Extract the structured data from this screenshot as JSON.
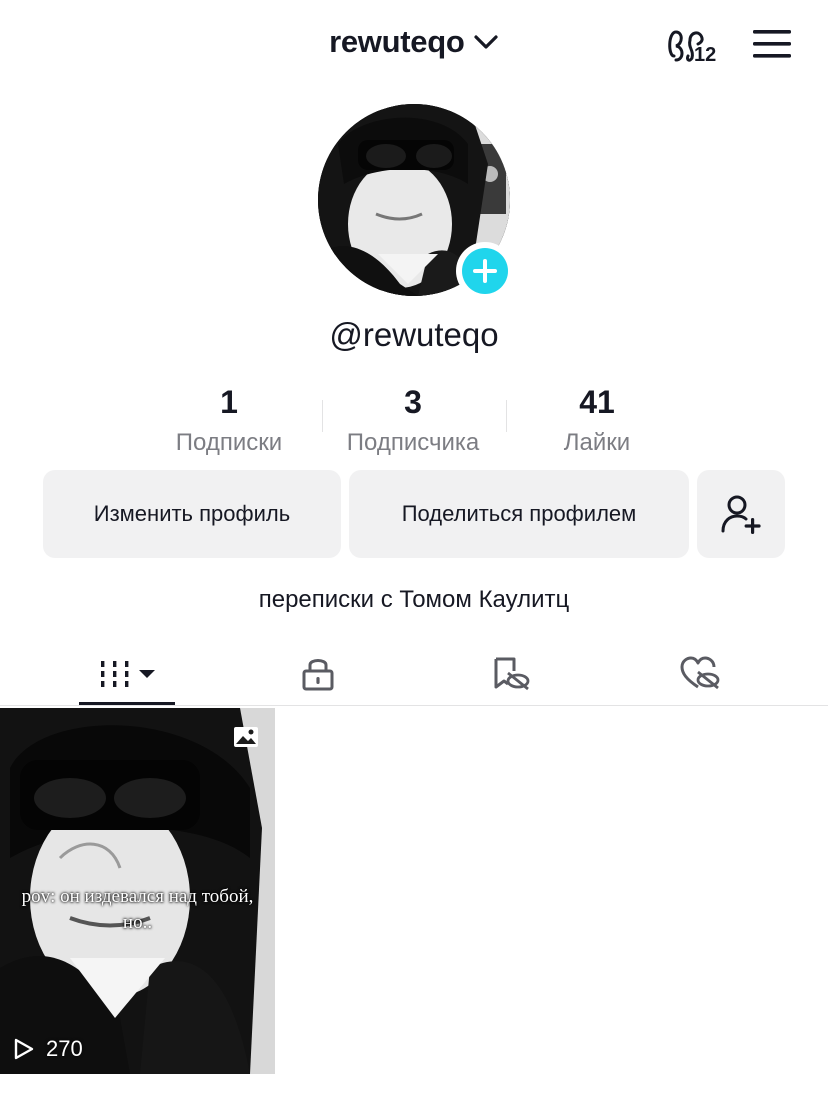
{
  "header": {
    "username": "rewuteqo",
    "friends_badge": "12"
  },
  "profile": {
    "handle": "@rewuteqo",
    "bio": "переписки с Томом Каулитц"
  },
  "stats": [
    {
      "value": "1",
      "label": "Подписки"
    },
    {
      "value": "3",
      "label": "Подписчика"
    },
    {
      "value": "41",
      "label": "Лайки"
    }
  ],
  "buttons": {
    "edit": "Изменить профиль",
    "share": "Поделиться профилем"
  },
  "tabs": [
    {
      "icon": "grid-icon",
      "active": true
    },
    {
      "icon": "lock-icon",
      "active": false
    },
    {
      "icon": "repost-hidden-icon",
      "active": false
    },
    {
      "icon": "heart-hidden-icon",
      "active": false
    }
  ],
  "videos": [
    {
      "caption_line1": "pov: он издевался над тобой,",
      "caption_line2": "но..",
      "views": "270",
      "type": "photo"
    }
  ],
  "colors": {
    "accent": "#20d5ec",
    "text": "#161823",
    "muted": "#7c7d83",
    "button_bg": "#f1f1f2"
  }
}
